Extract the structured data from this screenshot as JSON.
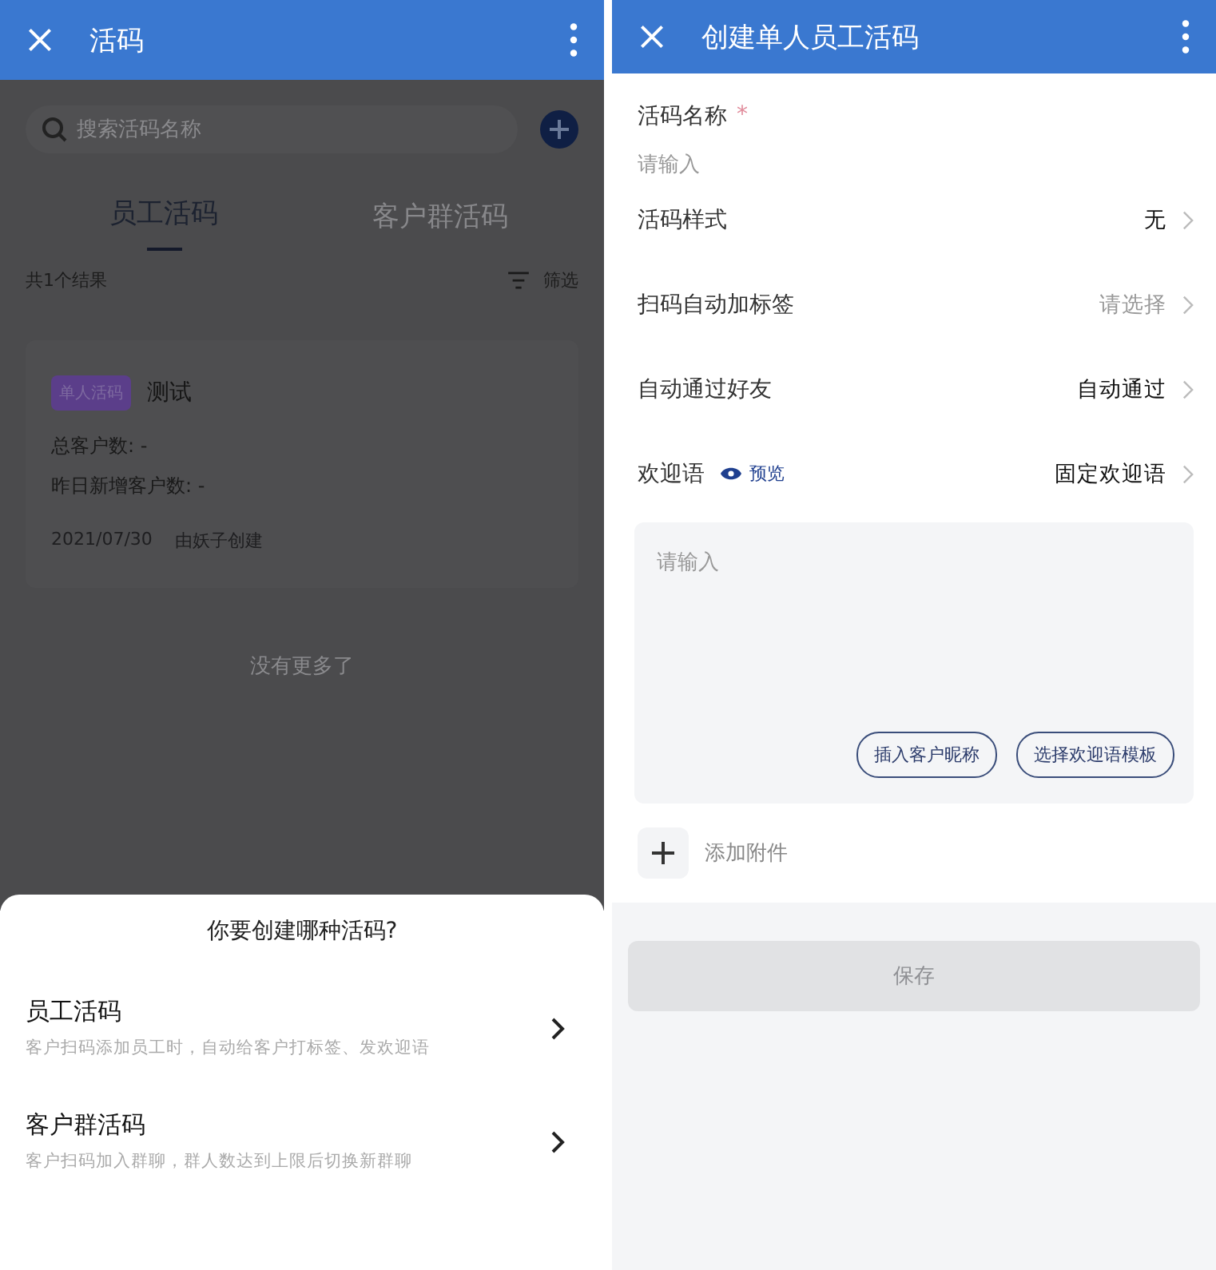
{
  "left": {
    "header": {
      "title": "活码"
    },
    "search": {
      "placeholder": "搜索活码名称"
    },
    "tabs": [
      {
        "label": "员工活码",
        "selected": true
      },
      {
        "label": "客户群活码",
        "selected": false
      }
    ],
    "result_count": "共1个结果",
    "filter": "筛选",
    "card": {
      "tag": "单人活码",
      "name": "测试",
      "stats": [
        "总客户数: -",
        "昨日新增客户数: -"
      ],
      "date": "2021/07/30",
      "creator": "由妖子创建"
    },
    "end_text": "没有更多了",
    "sheet": {
      "title": "你要创建哪种活码?",
      "options": [
        {
          "title": "员工活码",
          "description": "客户扫码添加员工时，自动给客户打标签、发欢迎语"
        },
        {
          "title": "客户群活码",
          "description": "客户扫码加入群聊，群人数达到上限后切换新群聊"
        }
      ]
    }
  },
  "right": {
    "header": {
      "title": "创建单人员工活码"
    },
    "name_field": {
      "label": "活码名称",
      "required": true,
      "required_mark": "*",
      "placeholder": "请输入"
    },
    "rows": [
      {
        "label": "活码样式",
        "value": "无",
        "muted": false
      },
      {
        "label": "扫码自动加标签",
        "value": "请选择",
        "muted": true
      },
      {
        "label": "自动通过好友",
        "value": "自动通过",
        "muted": false
      },
      {
        "label": "欢迎语",
        "preview": "预览",
        "value": "固定欢迎语",
        "muted": false
      }
    ],
    "welcome": {
      "placeholder": "请输入",
      "buttons": [
        "插入客户昵称",
        "选择欢迎语模板"
      ]
    },
    "attachment": "添加附件",
    "save": {
      "label": "保存",
      "disabled": true
    }
  }
}
